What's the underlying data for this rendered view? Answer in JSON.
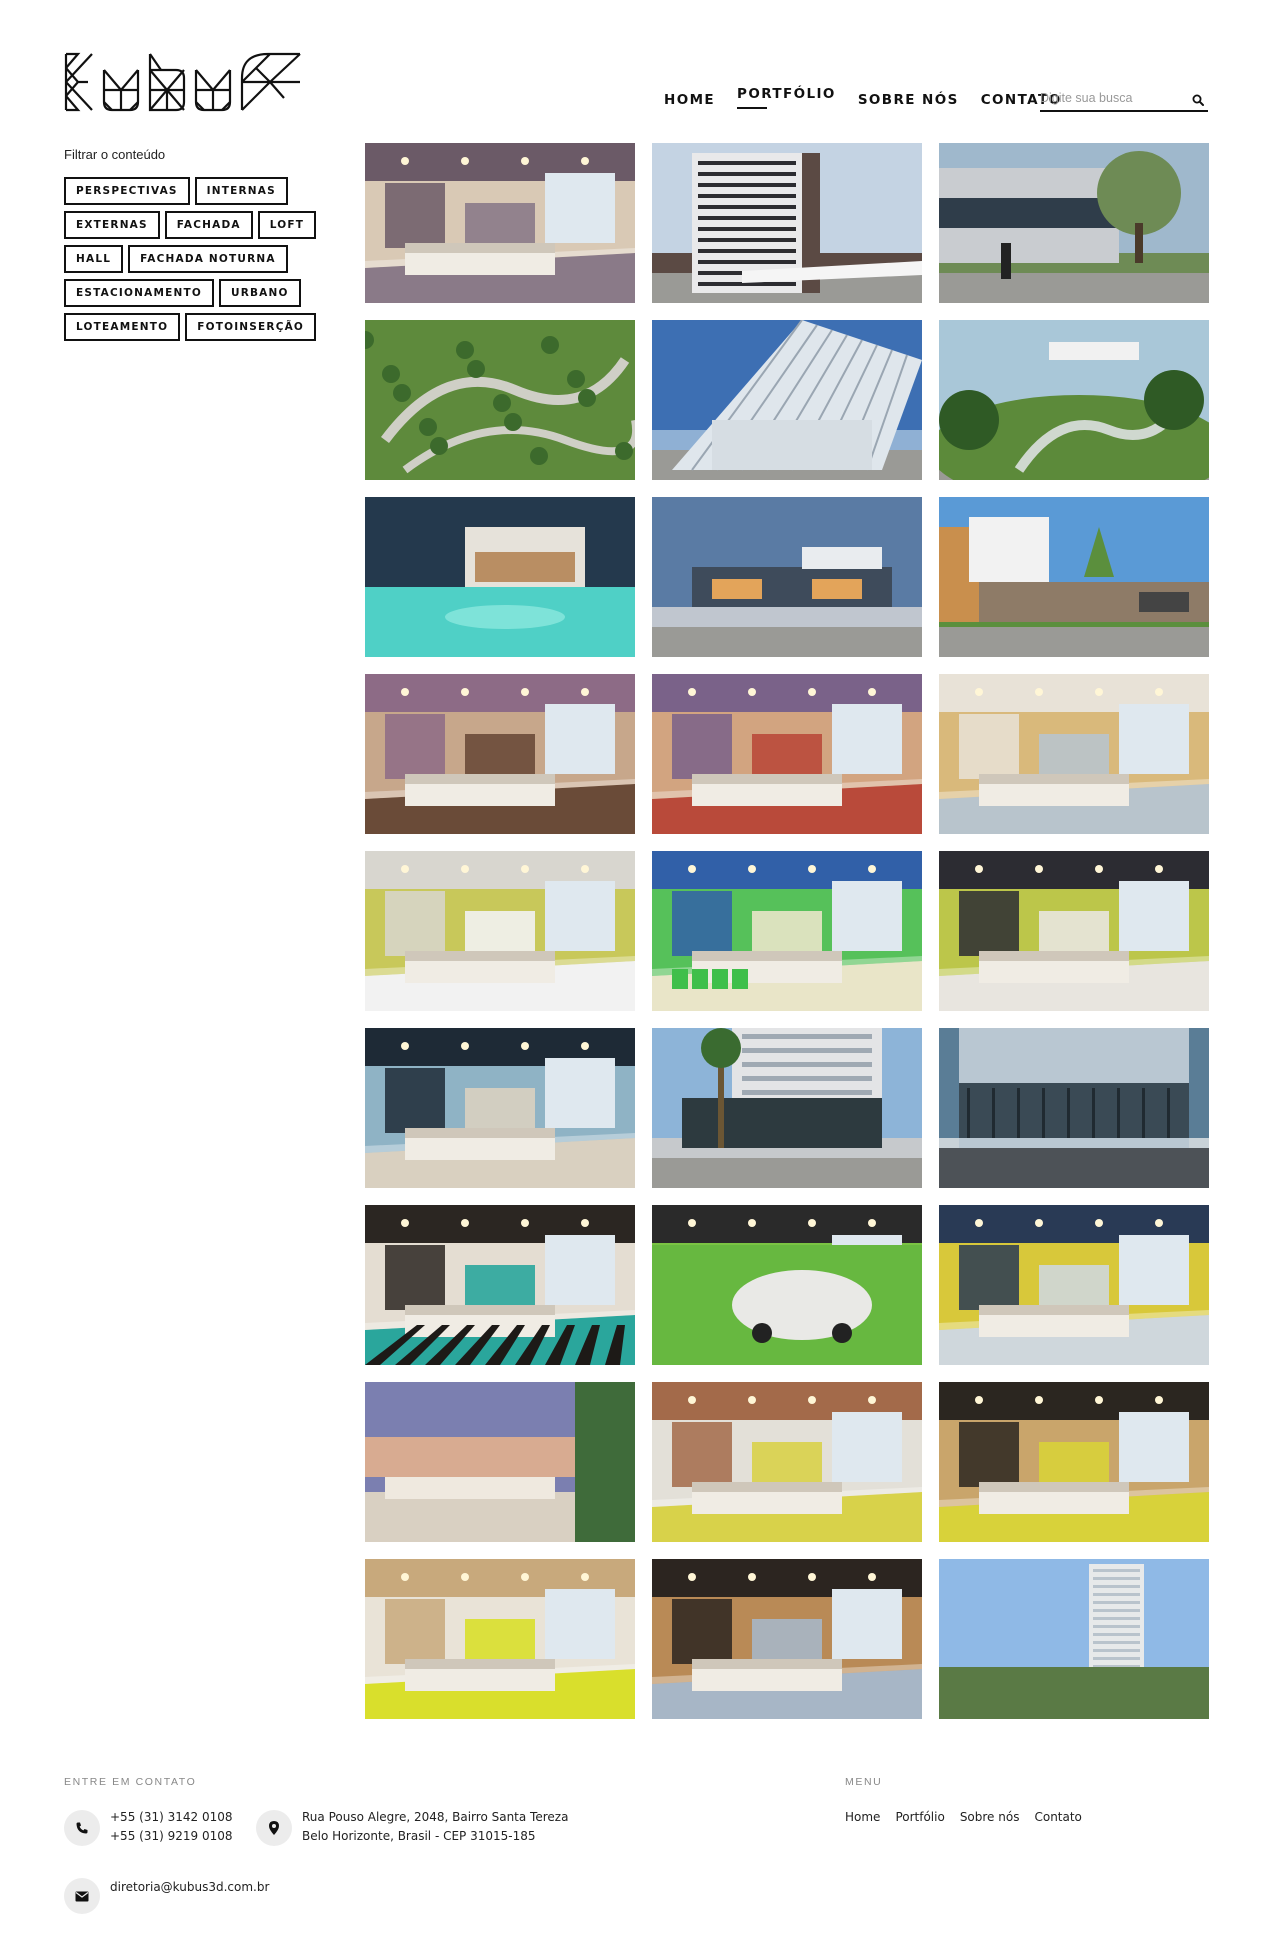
{
  "brand": {
    "logo_text": "Kubus"
  },
  "nav": {
    "items": [
      {
        "label": "HOME"
      },
      {
        "label": "PORTFÓLIO",
        "active": true
      },
      {
        "label": "SOBRE NÓS"
      },
      {
        "label": "CONTATO"
      }
    ],
    "search_placeholder": "Digite sua busca",
    "search_icon": "search-icon"
  },
  "filters": {
    "title": "Filtrar o conteúdo",
    "tags": [
      [
        "PERSPECTIVAS",
        "INTERNAS"
      ],
      [
        "EXTERNAS",
        "FACHADA",
        "LOFT"
      ],
      [
        "HALL",
        "FACHADA NOTURNA"
      ],
      [
        "ESTACIONAMENTO",
        "URBANO"
      ],
      [
        "LOTEAMENTO",
        "FOTOINSERÇÃO"
      ]
    ]
  },
  "gallery": {
    "items": [
      {
        "name": "apartamento-living",
        "scene": "interior",
        "colors": [
          "#6b5a67",
          "#d9c9b5",
          "#8a7a88"
        ]
      },
      {
        "name": "edificio-fachada",
        "scene": "tower",
        "colors": [
          "#c4d3e3",
          "#e9e9ea",
          "#5b4a44"
        ]
      },
      {
        "name": "rua-fachada-comercial",
        "scene": "street",
        "colors": [
          "#9fb8cc",
          "#7f8a86",
          "#6e8b55"
        ]
      },
      {
        "name": "loteamento-aereo",
        "scene": "aerial",
        "colors": [
          "#5e8a3c",
          "#cfcfc6",
          "#3c6a2c"
        ]
      },
      {
        "name": "estrutura-metalica",
        "scene": "canopy",
        "colors": [
          "#3d6fb3",
          "#dfe6ec",
          "#8fb0d4"
        ]
      },
      {
        "name": "condominio-paisagismo",
        "scene": "landscape",
        "colors": [
          "#a9c7d8",
          "#5c8a3a",
          "#cfd8cf"
        ]
      },
      {
        "name": "casa-piscina-noturna",
        "scene": "pool",
        "colors": [
          "#24394d",
          "#4fd0c6",
          "#b98e63"
        ]
      },
      {
        "name": "casa-jardim-entardecer",
        "scene": "dusk",
        "colors": [
          "#5a7ba4",
          "#3d6a2d",
          "#c0c6cf"
        ]
      },
      {
        "name": "casa-muro-pedra",
        "scene": "wall",
        "colors": [
          "#5a9ad6",
          "#8e7b67",
          "#5b8f3d"
        ]
      },
      {
        "name": "hall-encore",
        "scene": "lobby",
        "colors": [
          "#8d6b86",
          "#c7a78b",
          "#6a4b38"
        ]
      },
      {
        "name": "hall-recepcao",
        "scene": "lobby2",
        "colors": [
          "#7a6289",
          "#d2a480",
          "#b94a3a"
        ]
      },
      {
        "name": "escritorio-vista",
        "scene": "office",
        "colors": [
          "#e8e2d7",
          "#d9b97b",
          "#b8c4cc"
        ]
      },
      {
        "name": "quarto-hotel",
        "scene": "bedroom",
        "colors": [
          "#d8d6cf",
          "#c8c85a",
          "#f2f2f2"
        ]
      },
      {
        "name": "cozinha-gourmet",
        "scene": "kitchen",
        "colors": [
          "#3160a8",
          "#56c15a",
          "#e9e5c8"
        ]
      },
      {
        "name": "recepcao-balcao",
        "scene": "reception",
        "colors": [
          "#2c2c32",
          "#bcc64a",
          "#e8e5df"
        ]
      },
      {
        "name": "agencia-bancaria",
        "scene": "bank",
        "colors": [
          "#1e2a36",
          "#8fb3c5",
          "#d9d0c0"
        ]
      },
      {
        "name": "fachada-palmeiras",
        "scene": "palms",
        "colors": [
          "#8db4d8",
          "#3e5d38",
          "#c6c9cc"
        ]
      },
      {
        "name": "fachada-vidro-rua",
        "scene": "glass",
        "colors": [
          "#5a7d96",
          "#3a4a55",
          "#c9d2d8"
        ]
      },
      {
        "name": "hall-listrado",
        "scene": "striped",
        "colors": [
          "#2b2622",
          "#e4ddd2",
          "#2aa69c"
        ]
      },
      {
        "name": "estacionamento-eletrico",
        "scene": "parking",
        "colors": [
          "#2a2a2a",
          "#7ac443",
          "#d8d7d0"
        ]
      },
      {
        "name": "loft-cozinha-vista",
        "scene": "loftview",
        "colors": [
          "#293a55",
          "#d8c83a",
          "#cfd7dc"
        ]
      },
      {
        "name": "varanda-por-do-sol",
        "scene": "balcony",
        "colors": [
          "#7b7fb0",
          "#f0b78a",
          "#3f6b3a"
        ]
      },
      {
        "name": "living-tijolo",
        "scene": "living",
        "colors": [
          "#a36a4a",
          "#e3e0d8",
          "#d8d24a"
        ]
      },
      {
        "name": "sala-tv-escura",
        "scene": "tvroom",
        "colors": [
          "#2b2620",
          "#c9a56b",
          "#d8d23a"
        ]
      },
      {
        "name": "loft-quarto-sala",
        "scene": "loft",
        "colors": [
          "#c8a97c",
          "#e9e3d7",
          "#d9df2c"
        ]
      },
      {
        "name": "sala-escura-vista",
        "scene": "dark",
        "colors": [
          "#2c2520",
          "#b98a56",
          "#a7b6c6"
        ]
      },
      {
        "name": "torre-paisagem",
        "scene": "skyline",
        "colors": [
          "#8fb9e6",
          "#e7e9ea",
          "#5a7a45"
        ]
      }
    ]
  },
  "footer": {
    "contact_label": "ENTRE EM CONTATO",
    "phones": [
      "+55 (31) 3142 0108",
      "+55 (31) 9219 0108"
    ],
    "address": [
      "Rua Pouso Alegre, 2048, Bairro Santa Tereza",
      "Belo Horizonte, Brasil - CEP 31015-185"
    ],
    "email": "diretoria@kubus3d.com.br",
    "menu_label": "MENU",
    "menu": [
      "Home",
      "Portfólio",
      "Sobre nós",
      "Contato"
    ],
    "icons": [
      "phone-icon",
      "location-icon",
      "mail-icon"
    ]
  }
}
